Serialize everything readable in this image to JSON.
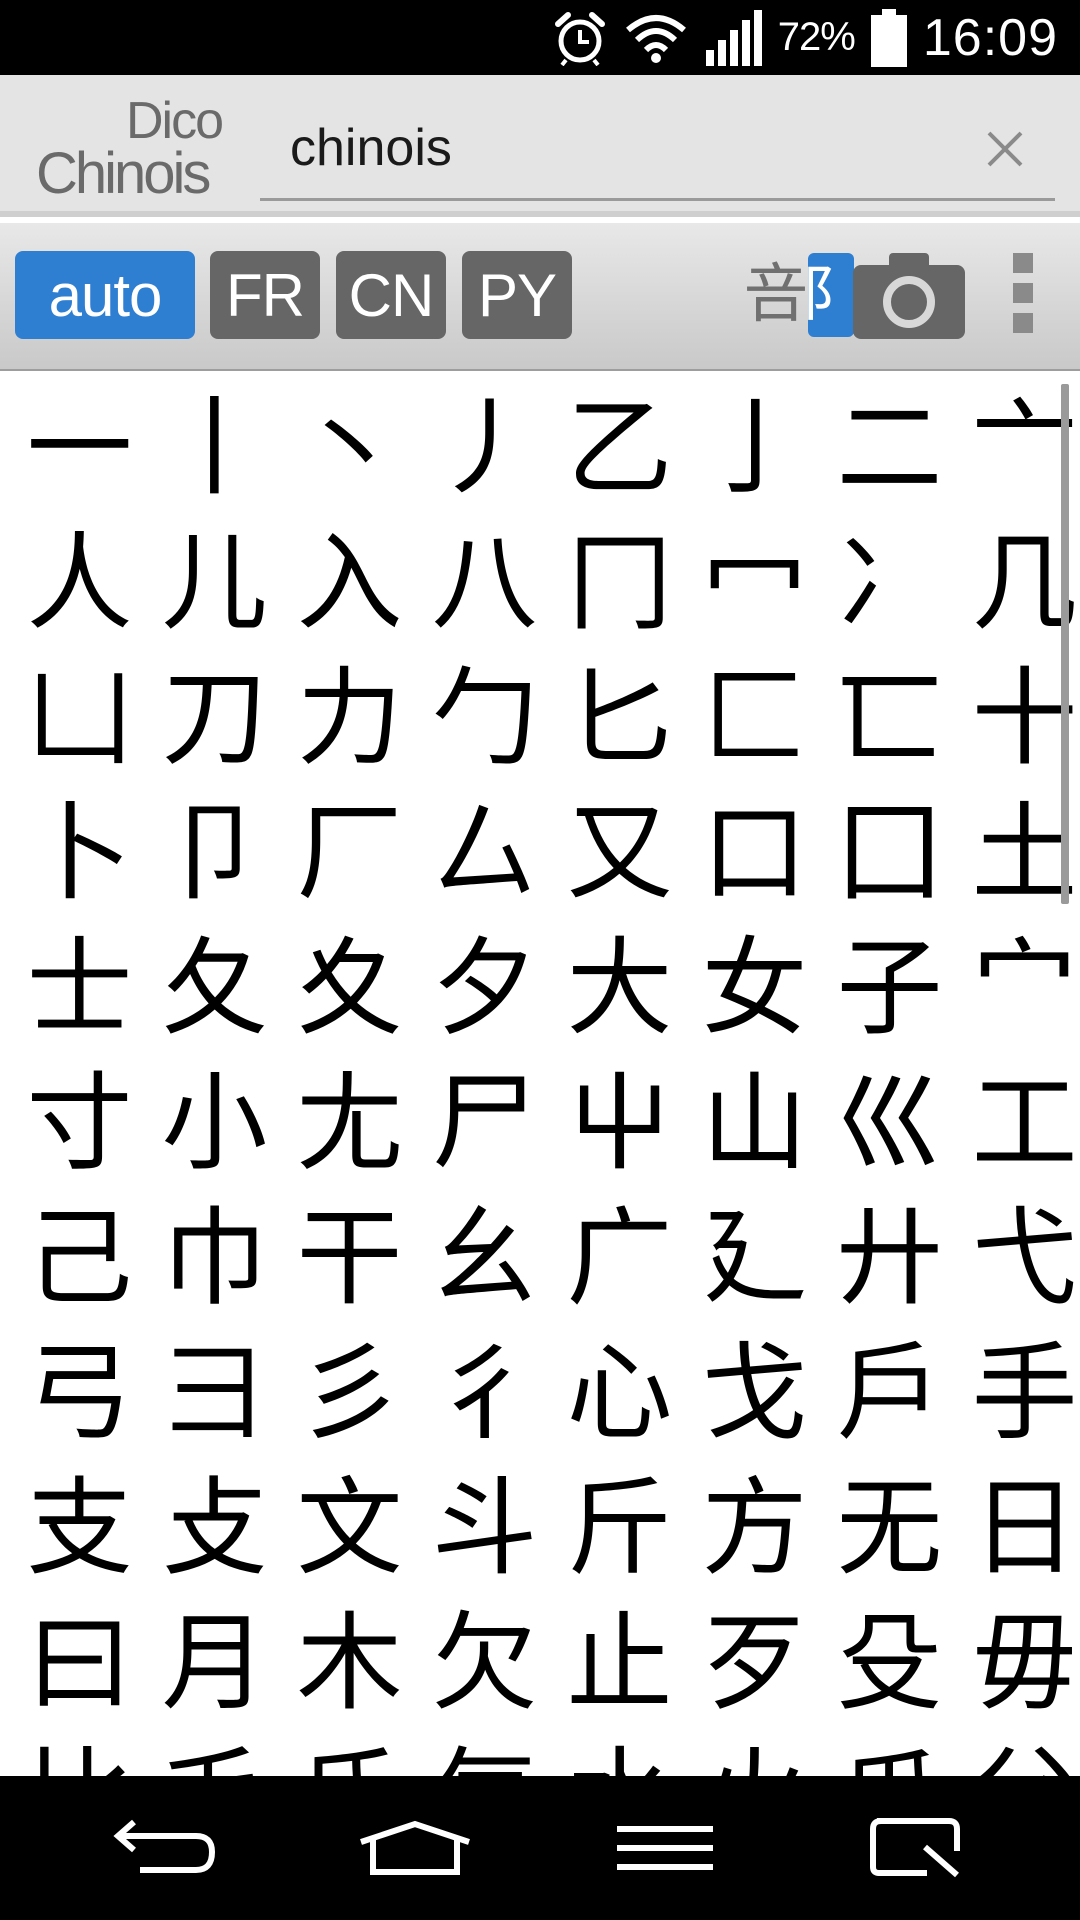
{
  "status_bar": {
    "battery_percent": "72%",
    "clock": "16:09",
    "icons": [
      "alarm-icon",
      "wifi-icon",
      "signal-icon",
      "battery-icon"
    ]
  },
  "header": {
    "logo_line1": "Dico",
    "logo_line2": "Chinois",
    "search_value": "chinois"
  },
  "toolbar": {
    "modes": [
      {
        "label": "auto",
        "active": true
      },
      {
        "label": "FR",
        "active": false
      },
      {
        "label": "CN",
        "active": false
      },
      {
        "label": "PY",
        "active": false
      }
    ],
    "radical_left": "咅",
    "radical_right": "阝"
  },
  "radicals": [
    "一",
    "丨",
    "丶",
    "丿",
    "乙",
    "亅",
    "二",
    "亠",
    "人",
    "儿",
    "入",
    "八",
    "冂",
    "冖",
    "冫",
    "几",
    "凵",
    "刀",
    "力",
    "勹",
    "匕",
    "匚",
    "匸",
    "十",
    "卜",
    "卩",
    "厂",
    "厶",
    "又",
    "口",
    "囗",
    "土",
    "士",
    "夂",
    "夊",
    "夕",
    "大",
    "女",
    "子",
    "宀",
    "寸",
    "小",
    "尢",
    "尸",
    "屮",
    "山",
    "巛",
    "工",
    "己",
    "巾",
    "干",
    "幺",
    "广",
    "廴",
    "廾",
    "弋",
    "弓",
    "彐",
    "彡",
    "彳",
    "心",
    "戈",
    "戶",
    "手",
    "支",
    "攴",
    "文",
    "斗",
    "斤",
    "方",
    "无",
    "日",
    "曰",
    "月",
    "木",
    "欠",
    "止",
    "歹",
    "殳",
    "毋",
    "比",
    "毛",
    "氏",
    "气",
    "水",
    "火",
    "爪",
    "父"
  ],
  "colors": {
    "accent": "#2e7fd2",
    "mode_inactive": "#666666",
    "header_bg": "#e4e4e4"
  }
}
